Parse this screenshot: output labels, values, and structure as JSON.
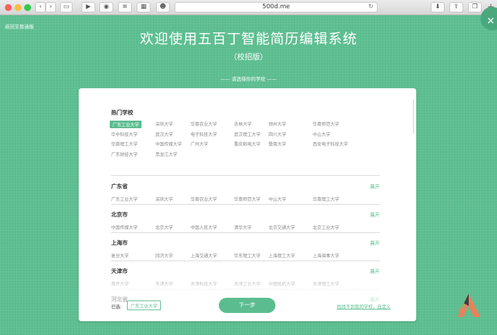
{
  "browser": {
    "url": "500d.me",
    "toolbar_icons": [
      "back-icon",
      "forward-icon",
      "sidebar-icon",
      "play-icon",
      "reader-icon",
      "rss-icon",
      "bookmark-icon",
      "grammarly-icon",
      "reload-icon",
      "download-icon",
      "share-icon",
      "tabs-icon",
      "new-tab-icon"
    ],
    "new_tab": "+"
  },
  "header": {
    "back_link": "返回至普通版",
    "title": "欢迎使用五百丁智能简历编辑系统",
    "subtitle": "（校招版）",
    "prompt": "—— 请选择你的学校 ——",
    "close": "✕"
  },
  "hot": {
    "title": "热门学校",
    "rows": [
      [
        "广东工业大学",
        "深圳大学",
        "华南农业大学",
        "吉林大学",
        "郑州大学",
        "华南师范大学"
      ],
      [
        "华中科技大学",
        "武汉大学",
        "电子科技大学",
        "武汉理工大学",
        "四川大学",
        "中山大学"
      ],
      [
        "华南理工大学",
        "中国传媒大学",
        "广州大学",
        "重庆邮电大学",
        "暨南大学",
        "西安电子科技大学"
      ],
      [
        "广东财经大学",
        "黑龙江大学"
      ]
    ],
    "selected": "广东工业大学"
  },
  "regions": [
    {
      "name": "广东省",
      "expand": "展开",
      "schools": [
        "广东工业大学",
        "深圳大学",
        "华南农业大学",
        "华南师范大学",
        "中山大学",
        "华南理工大学"
      ]
    },
    {
      "name": "北京市",
      "expand": "展开",
      "schools": [
        "中国传媒大学",
        "北京大学",
        "中国人民大学",
        "清华大学",
        "北京交通大学",
        "北京工业大学"
      ]
    },
    {
      "name": "上海市",
      "expand": "展开",
      "schools": [
        "复旦大学",
        "同济大学",
        "上海交通大学",
        "华东理工大学",
        "上海理工大学",
        "上海海事大学"
      ]
    },
    {
      "name": "天津市",
      "expand": "展开",
      "schools": [
        "南开大学",
        "天津大学",
        "天津科技大学",
        "天津工业大学",
        "中国民航大学",
        "天津理工大学"
      ]
    },
    {
      "name": "河北省",
      "expand": "展开",
      "schools": []
    }
  ],
  "footer": {
    "selected_label": "已选:",
    "selected_value": "广东工业大学",
    "next_button": "下一步",
    "custom_link": "找找不到我的学校，自定义"
  },
  "colors": {
    "accent": "#5bbd8f",
    "logo_orange": "#e8825a",
    "logo_dark": "#3f3f3f"
  }
}
